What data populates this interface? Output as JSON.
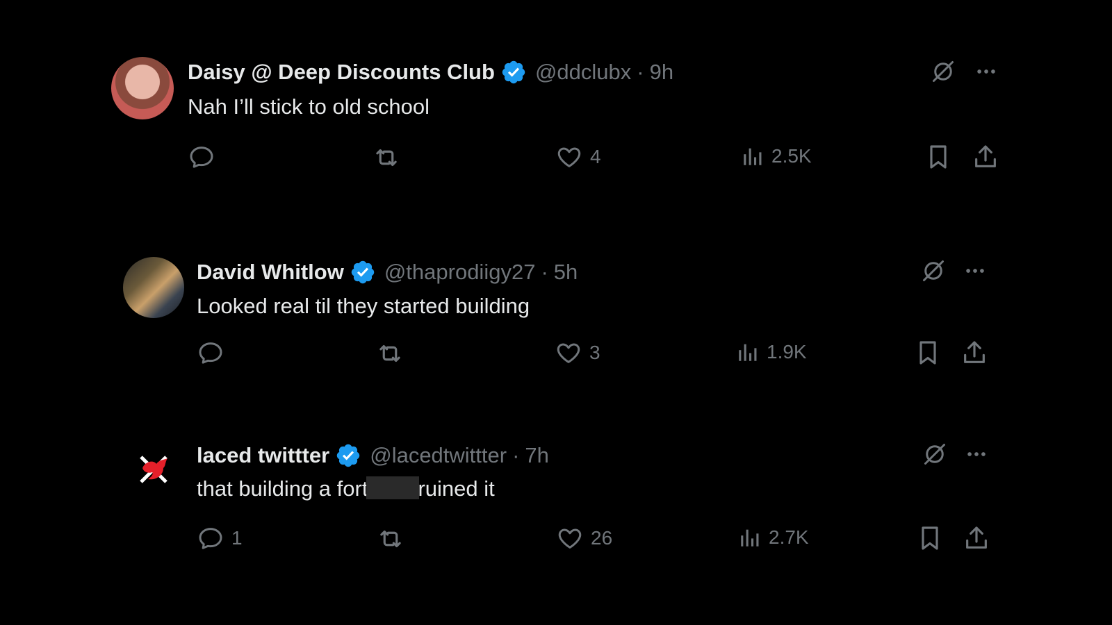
{
  "colors": {
    "background": "#000000",
    "text": "#e7e9ea",
    "muted": "#71767b",
    "verified": "#1d9bf0",
    "redaction": "#2a2a2a"
  },
  "tweets": [
    {
      "name": "Daisy @ Deep Discounts Club",
      "handle": "@ddclubx",
      "separator": "·",
      "time": "9h",
      "text": "Nah I’ll stick to old school",
      "reply_count": "",
      "like_count": "4",
      "view_count": "2.5K"
    },
    {
      "name": "David Whitlow",
      "handle": "@thaprodiigy27",
      "separator": "·",
      "time": "5h",
      "text": "Looked real til they started building",
      "reply_count": "",
      "like_count": "3",
      "view_count": "1.9K"
    },
    {
      "name": "laced twittter",
      "handle": "@lacedtwittter",
      "separator": "·",
      "time": "7h",
      "text_before": "that building a fort",
      "text_after": "ruined it",
      "reply_count": "1",
      "like_count": "26",
      "view_count": "2.7K"
    }
  ],
  "icons": [
    "verified-icon",
    "grok-icon",
    "more-icon",
    "reply-icon",
    "retweet-icon",
    "like-icon",
    "views-icon",
    "bookmark-icon",
    "share-icon"
  ]
}
